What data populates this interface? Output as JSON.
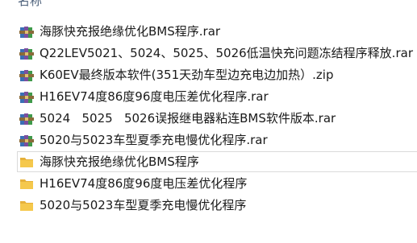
{
  "header": {
    "column_name": "名称"
  },
  "files": [
    {
      "name": "海豚快充报绝缘优化BMS程序.rar",
      "type": "archive",
      "icon": "winrar-archive-icon",
      "selected": false
    },
    {
      "name": "Q22LEV5021、5024、5025、5026低温快充问题冻结程序释放.rar",
      "type": "archive",
      "icon": "winrar-archive-icon",
      "selected": false
    },
    {
      "name": "K60EV最终版本软件(351天劲车型边充电边加热）.zip",
      "type": "archive",
      "icon": "winrar-archive-icon",
      "selected": false
    },
    {
      "name": "H16EV74度86度96度电压差优化程序.rar",
      "type": "archive",
      "icon": "winrar-archive-icon",
      "selected": false
    },
    {
      "name": "5024   5025   5026误报继电器粘连BMS软件版本.rar",
      "type": "archive",
      "icon": "winrar-archive-icon",
      "selected": false
    },
    {
      "name": "5020与5023车型夏季充电慢优化程序.rar",
      "type": "archive",
      "icon": "winrar-archive-icon",
      "selected": false
    },
    {
      "name": "海豚快充报绝缘优化BMS程序",
      "type": "folder",
      "icon": "folder-icon",
      "selected": true
    },
    {
      "name": "H16EV74度86度96度电压差优化程序",
      "type": "folder",
      "icon": "folder-icon",
      "selected": false
    },
    {
      "name": "5020与5023车型夏季充电慢优化程序",
      "type": "folder",
      "icon": "folder-icon",
      "selected": false
    }
  ],
  "colors": {
    "folder": "#f5c84c",
    "archive_book_blue": "#3a6fb5",
    "archive_book_purple": "#7a4f9e",
    "archive_book_green": "#3f9a4a",
    "selection_border": "#dadada",
    "header_text": "#4c607a"
  }
}
